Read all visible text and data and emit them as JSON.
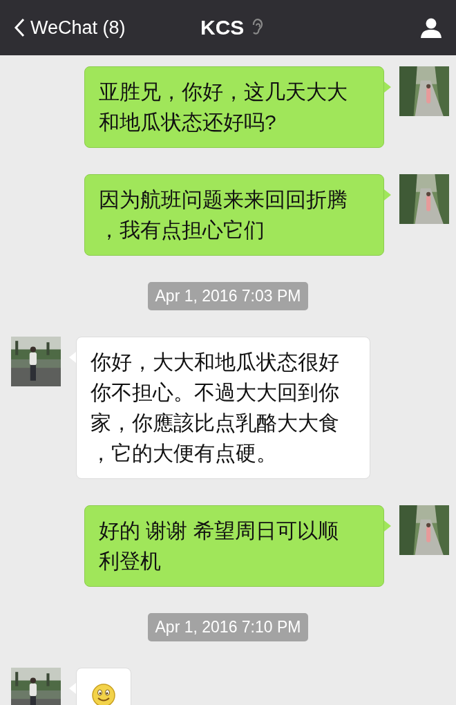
{
  "header": {
    "back_label": "WeChat (8)",
    "title": "KCS"
  },
  "messages": [
    {
      "kind": "text",
      "outgoing": true,
      "text": "亚胜兄，你好，这几天大大和地瓜状态还好吗?"
    },
    {
      "kind": "text",
      "outgoing": true,
      "text": "因为航班问题来来回回折腾，我有点担心它们"
    },
    {
      "kind": "time",
      "text": "Apr 1, 2016 7:03 PM"
    },
    {
      "kind": "text",
      "outgoing": false,
      "text": "你好，大大和地瓜状态很好你不担心。不過大大回到你家，你應該比点乳酪大大食，它的大便有点硬。"
    },
    {
      "kind": "text",
      "outgoing": true,
      "text": "好的 谢谢 希望周日可以顺利登机"
    },
    {
      "kind": "time",
      "text": "Apr 1, 2016 7:10 PM"
    },
    {
      "kind": "emoji",
      "outgoing": false
    }
  ]
}
